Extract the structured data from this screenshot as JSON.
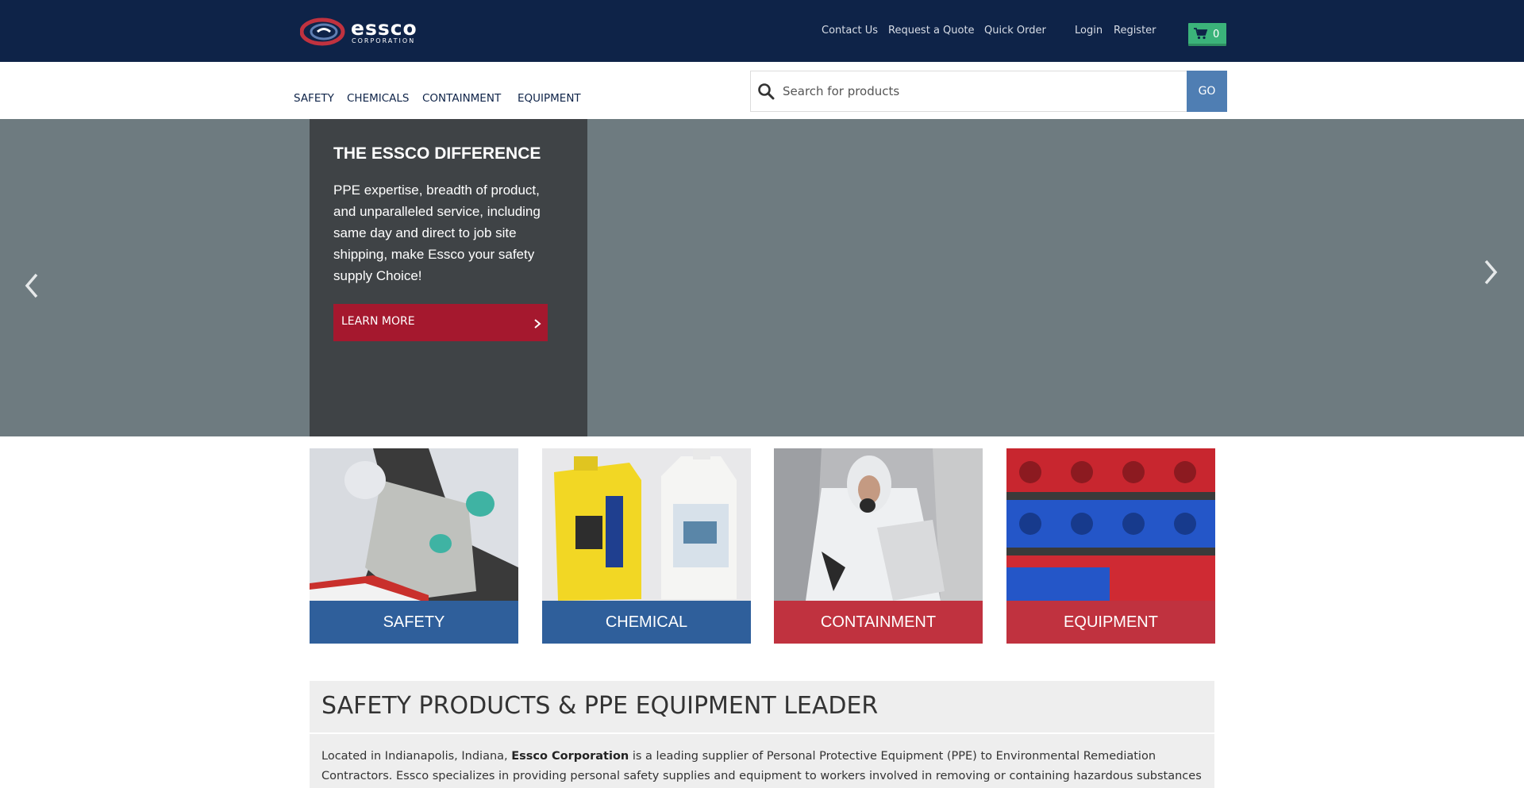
{
  "brand": {
    "name": "essco",
    "subtitle": "CORPORATION",
    "colors": {
      "navy": "#0e2348",
      "red": "#a5182e",
      "blue": "#2f5f9b",
      "cart_green": "#3bb37a"
    }
  },
  "header": {
    "links": [
      "Contact Us",
      "Request a Quote",
      "Quick Order",
      "Login",
      "Register"
    ],
    "cart": {
      "icon": "shopping-cart-icon",
      "count": "0"
    }
  },
  "nav": {
    "items": [
      "SAFETY",
      "CHEMICALS",
      "CONTAINMENT",
      "EQUIPMENT"
    ]
  },
  "search": {
    "icon": "search-icon",
    "placeholder": "Search for products",
    "value": "",
    "button": "GO"
  },
  "hero": {
    "title": "THE ESSCO DIFFERENCE",
    "text": "PPE expertise, breadth of product, and unparalleled service, including same day and direct to job site shipping, make Essco your safety supply Choice!",
    "cta": "LEARN MORE",
    "prev_icon": "chevron-left-icon",
    "next_icon": "chevron-right-icon"
  },
  "categories": [
    {
      "label": "SAFETY",
      "color": "#2f5f9b"
    },
    {
      "label": "CHEMICAL",
      "color": "#2f5f9b"
    },
    {
      "label": "CONTAINMENT",
      "color": "#c0323f"
    },
    {
      "label": "EQUIPMENT",
      "color": "#c0323f"
    }
  ],
  "intro": {
    "heading": "SAFETY PRODUCTS & PPE EQUIPMENT LEADER",
    "text_before": "Located in Indianapolis, Indiana, ",
    "bold": "Essco Corporation",
    "text_after": " is a leading supplier of Personal Protective Equipment (PPE) to Environmental Remediation Contractors. Essco specializes in providing personal safety supplies and equipment to workers involved in removing or containing hazardous substances including asbestos,"
  }
}
